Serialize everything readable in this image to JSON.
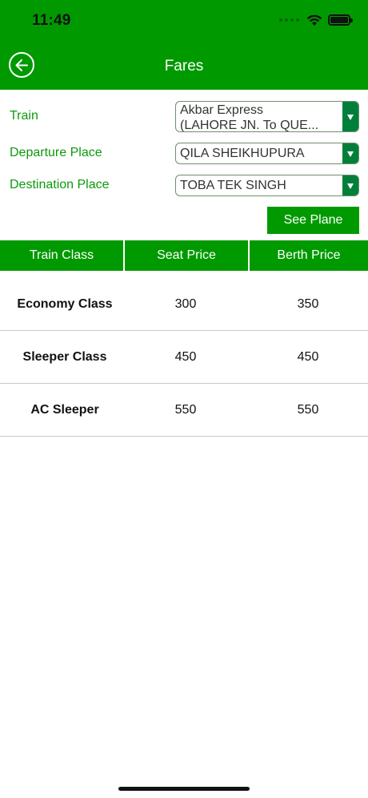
{
  "status_bar": {
    "time": "11:49"
  },
  "header": {
    "title": "Fares"
  },
  "form": {
    "train": {
      "label": "Train",
      "value_line1": "Akbar Express",
      "value_line2": "(LAHORE JN. To QUE..."
    },
    "departure": {
      "label": "Departure Place",
      "value": "QILA SHEIKHUPURA"
    },
    "destination": {
      "label": "Destination Place",
      "value": "TOBA TEK SINGH"
    },
    "submit_label": "See Plane"
  },
  "table": {
    "headers": [
      "Train Class",
      "Seat Price",
      "Berth Price"
    ],
    "rows": [
      [
        "Economy Class",
        "300",
        "350"
      ],
      [
        "Sleeper Class",
        "450",
        "450"
      ],
      [
        "AC Sleeper",
        "550",
        "550"
      ]
    ]
  },
  "colors": {
    "primary_green": "#009a00",
    "label_green": "#0c9a0c",
    "dropdown_green": "#007f3a"
  }
}
